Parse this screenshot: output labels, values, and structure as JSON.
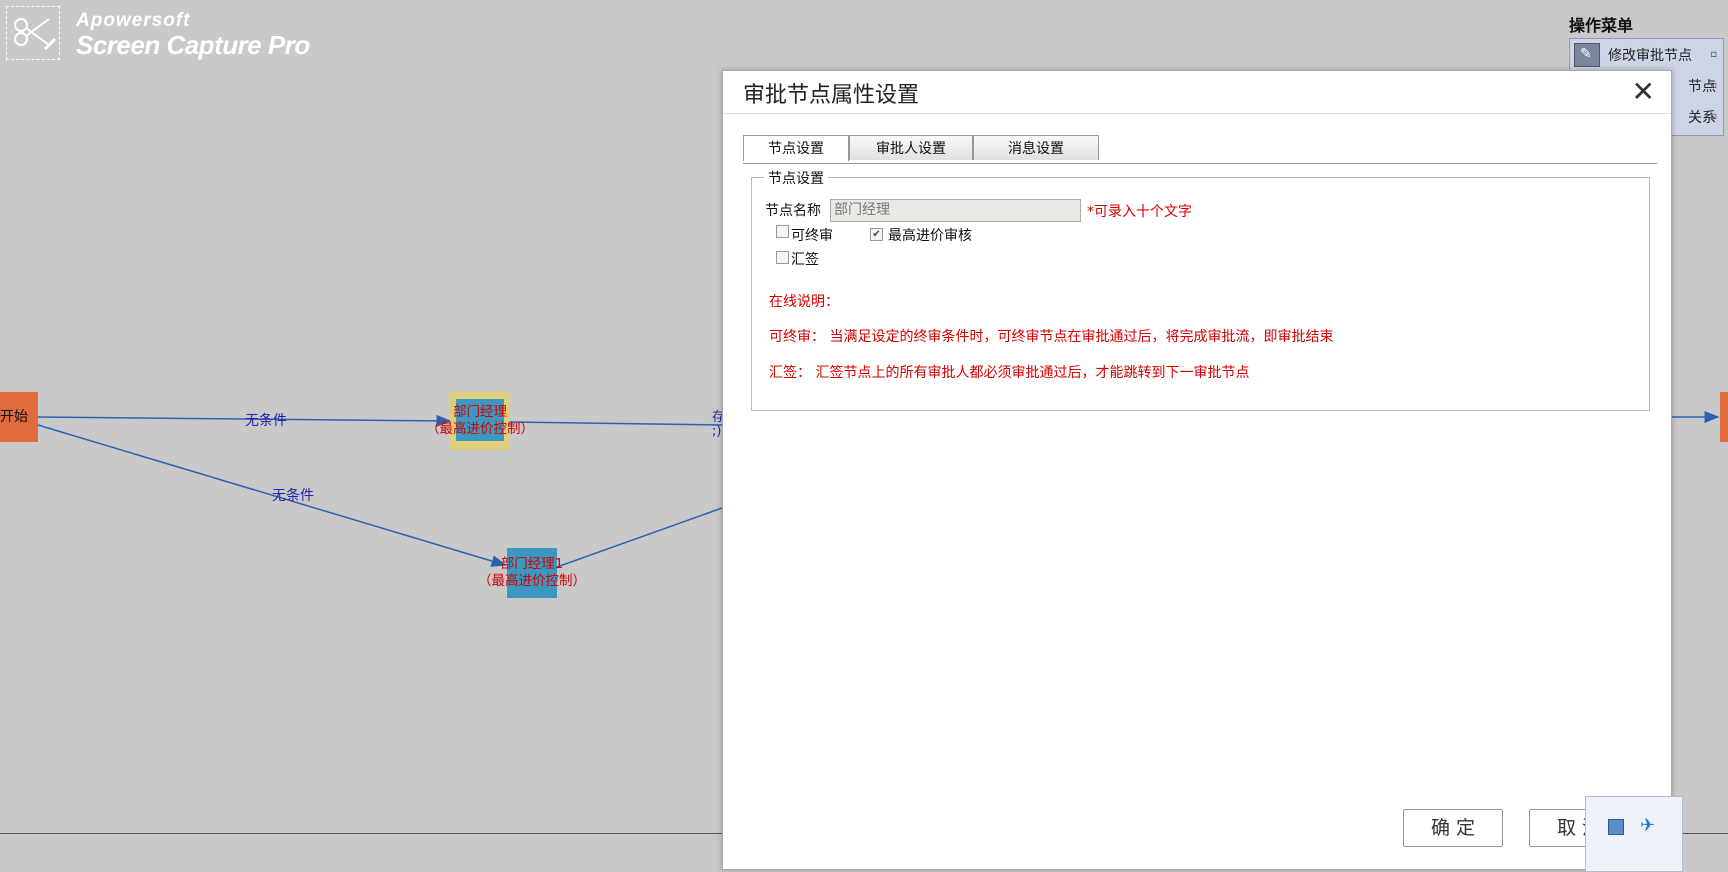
{
  "watermark": {
    "line1": "Apowersoft",
    "line2": "Screen Capture Pro"
  },
  "flow": {
    "start_label": "开始",
    "edge_labels": [
      "无条件",
      "无条件"
    ],
    "node1": {
      "line1": "部门经理",
      "line2": "（最高进价控制）"
    },
    "node2": {
      "line1": "部门经理1",
      "line2": "（最高进价控制）"
    },
    "partial_edge_text": [
      "存",
      ";)"
    ]
  },
  "menu": {
    "title": "操作菜单",
    "items": [
      {
        "label": "修改审批节点",
        "icon": "edit-icon"
      },
      {
        "label": "节点"
      },
      {
        "label": "关系"
      }
    ]
  },
  "dialog": {
    "title": "审批节点属性设置",
    "tabs": [
      "节点设置",
      "审批人设置",
      "消息设置"
    ],
    "fieldset_legend": "节点设置",
    "name_label": "节点名称",
    "name_value": "部门经理",
    "name_hint": "*可录入十个文字",
    "checkboxes": [
      {
        "label": "可终审",
        "checked": false
      },
      {
        "label": "最高进价审核",
        "checked": true
      },
      {
        "label": "汇签",
        "checked": false
      }
    ],
    "help_title": "在线说明：",
    "help_final": "可终审：  当满足设定的终审条件时，可终审节点在审批通过后，将完成审批流，即审批结束",
    "help_countersign": "汇签：  汇签节点上的所有审批人都必须审批通过后，才能跳转到下一审批节点",
    "ok_button": "确 定",
    "cancel_button": "取 消"
  },
  "colors": {
    "accent_red": "#d40000",
    "node_blue": "#3c97c1",
    "start_orange": "#e06b3c"
  }
}
